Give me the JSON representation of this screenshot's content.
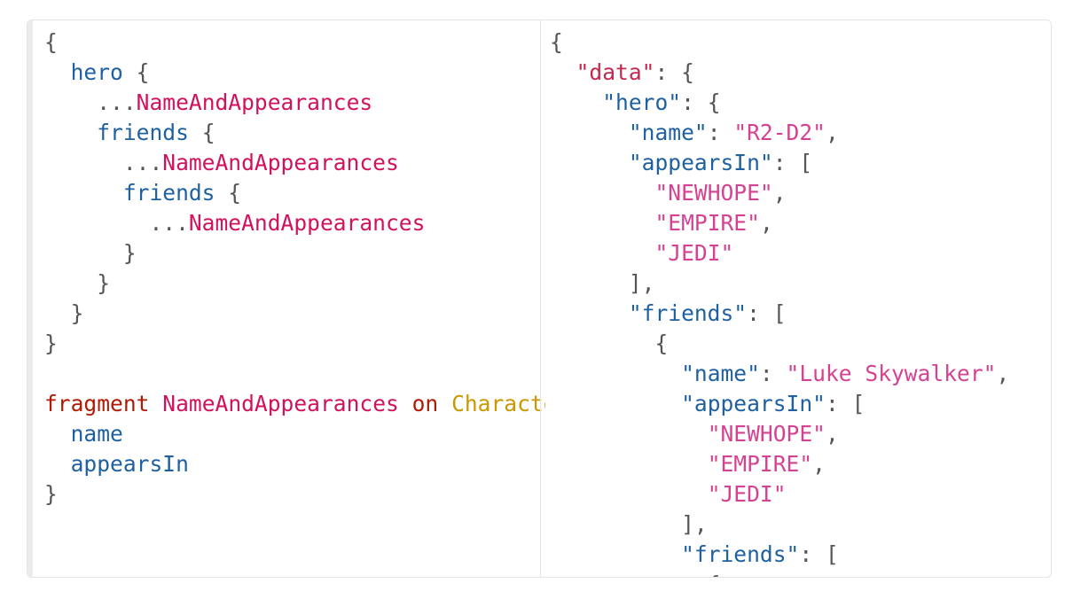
{
  "query_editor": {
    "lines": [
      [
        {
          "t": "{",
          "c": "p"
        }
      ],
      [
        {
          "t": "  ",
          "c": "p"
        },
        {
          "t": "hero",
          "c": "f"
        },
        {
          "t": " {",
          "c": "p"
        }
      ],
      [
        {
          "t": "    ...",
          "c": "p"
        },
        {
          "t": "NameAndAppearances",
          "c": "s"
        }
      ],
      [
        {
          "t": "    ",
          "c": "p"
        },
        {
          "t": "friends",
          "c": "f"
        },
        {
          "t": " {",
          "c": "p"
        }
      ],
      [
        {
          "t": "      ...",
          "c": "p"
        },
        {
          "t": "NameAndAppearances",
          "c": "s"
        }
      ],
      [
        {
          "t": "      ",
          "c": "p"
        },
        {
          "t": "friends",
          "c": "f"
        },
        {
          "t": " {",
          "c": "p"
        }
      ],
      [
        {
          "t": "        ...",
          "c": "p"
        },
        {
          "t": "NameAndAppearances",
          "c": "s"
        }
      ],
      [
        {
          "t": "      }",
          "c": "p"
        }
      ],
      [
        {
          "t": "    }",
          "c": "p"
        }
      ],
      [
        {
          "t": "  }",
          "c": "p"
        }
      ],
      [
        {
          "t": "}",
          "c": "p"
        }
      ],
      [
        {
          "t": "",
          "c": "p"
        }
      ],
      [
        {
          "t": "fragment",
          "c": "k"
        },
        {
          "t": " ",
          "c": "p"
        },
        {
          "t": "NameAndAppearances",
          "c": "d"
        },
        {
          "t": " ",
          "c": "p"
        },
        {
          "t": "on",
          "c": "k"
        },
        {
          "t": " ",
          "c": "p"
        },
        {
          "t": "Character",
          "c": "t"
        },
        {
          "t": " {",
          "c": "p"
        }
      ],
      [
        {
          "t": "  ",
          "c": "p"
        },
        {
          "t": "name",
          "c": "f"
        }
      ],
      [
        {
          "t": "  ",
          "c": "p"
        },
        {
          "t": "appearsIn",
          "c": "f"
        }
      ],
      [
        {
          "t": "}",
          "c": "p"
        }
      ]
    ]
  },
  "result_viewer": {
    "lines": [
      [
        {
          "t": "{",
          "c": "p"
        }
      ],
      [
        {
          "t": "  ",
          "c": "p"
        },
        {
          "t": "\"data\"",
          "c": "dk"
        },
        {
          "t": ": {",
          "c": "p"
        }
      ],
      [
        {
          "t": "    ",
          "c": "p"
        },
        {
          "t": "\"hero\"",
          "c": "key"
        },
        {
          "t": ": {",
          "c": "p"
        }
      ],
      [
        {
          "t": "      ",
          "c": "p"
        },
        {
          "t": "\"name\"",
          "c": "key"
        },
        {
          "t": ": ",
          "c": "p"
        },
        {
          "t": "\"R2-D2\"",
          "c": "str"
        },
        {
          "t": ",",
          "c": "p"
        }
      ],
      [
        {
          "t": "      ",
          "c": "p"
        },
        {
          "t": "\"appearsIn\"",
          "c": "key"
        },
        {
          "t": ": [",
          "c": "p"
        }
      ],
      [
        {
          "t": "        ",
          "c": "p"
        },
        {
          "t": "\"NEWHOPE\"",
          "c": "str"
        },
        {
          "t": ",",
          "c": "p"
        }
      ],
      [
        {
          "t": "        ",
          "c": "p"
        },
        {
          "t": "\"EMPIRE\"",
          "c": "str"
        },
        {
          "t": ",",
          "c": "p"
        }
      ],
      [
        {
          "t": "        ",
          "c": "p"
        },
        {
          "t": "\"JEDI\"",
          "c": "str"
        }
      ],
      [
        {
          "t": "      ],",
          "c": "p"
        }
      ],
      [
        {
          "t": "      ",
          "c": "p"
        },
        {
          "t": "\"friends\"",
          "c": "key"
        },
        {
          "t": ": [",
          "c": "p"
        }
      ],
      [
        {
          "t": "        {",
          "c": "p"
        }
      ],
      [
        {
          "t": "          ",
          "c": "p"
        },
        {
          "t": "\"name\"",
          "c": "key"
        },
        {
          "t": ": ",
          "c": "p"
        },
        {
          "t": "\"Luke Skywalker\"",
          "c": "str"
        },
        {
          "t": ",",
          "c": "p"
        }
      ],
      [
        {
          "t": "          ",
          "c": "p"
        },
        {
          "t": "\"appearsIn\"",
          "c": "key"
        },
        {
          "t": ": [",
          "c": "p"
        }
      ],
      [
        {
          "t": "            ",
          "c": "p"
        },
        {
          "t": "\"NEWHOPE\"",
          "c": "str"
        },
        {
          "t": ",",
          "c": "p"
        }
      ],
      [
        {
          "t": "            ",
          "c": "p"
        },
        {
          "t": "\"EMPIRE\"",
          "c": "str"
        },
        {
          "t": ",",
          "c": "p"
        }
      ],
      [
        {
          "t": "            ",
          "c": "p"
        },
        {
          "t": "\"JEDI\"",
          "c": "str"
        }
      ],
      [
        {
          "t": "          ],",
          "c": "p"
        }
      ],
      [
        {
          "t": "          ",
          "c": "p"
        },
        {
          "t": "\"friends\"",
          "c": "key"
        },
        {
          "t": ": [",
          "c": "p"
        }
      ],
      [
        {
          "t": "            {",
          "c": "p"
        }
      ]
    ]
  }
}
